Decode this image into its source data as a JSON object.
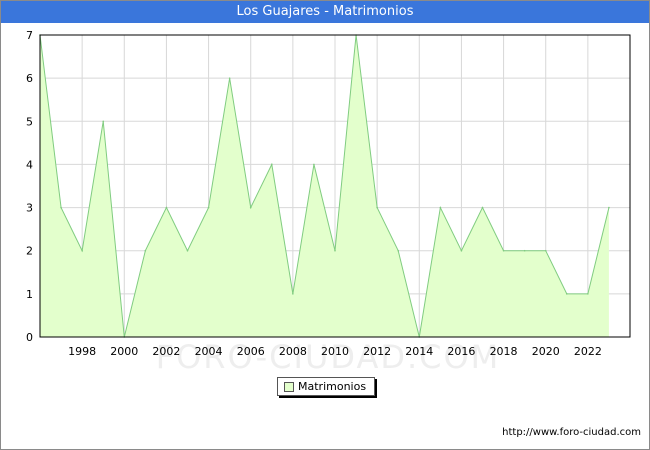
{
  "title": "Los Guajares - Matrimonios",
  "watermark": "FORO-CIUDAD.COM",
  "footer_url": "http://www.foro-ciudad.com",
  "colors": {
    "header": "#3a76db",
    "area_fill": "#e3ffcc",
    "line": "#80cc80",
    "grid": "#d8d8d8"
  },
  "chart_data": {
    "type": "area",
    "title": "Los Guajares - Matrimonios",
    "x": [
      1996,
      1997,
      1998,
      1999,
      2000,
      2001,
      2002,
      2003,
      2004,
      2005,
      2006,
      2007,
      2008,
      2009,
      2010,
      2011,
      2012,
      2013,
      2014,
      2015,
      2016,
      2017,
      2018,
      2019,
      2020,
      2021,
      2022,
      2023
    ],
    "series": [
      {
        "name": "Matrimonios",
        "values": [
          7,
          3,
          2,
          5,
          0,
          2,
          3,
          2,
          3,
          6,
          3,
          4,
          1,
          4,
          2,
          7,
          3,
          2,
          0,
          3,
          2,
          3,
          2,
          2,
          2,
          1,
          1,
          3
        ]
      }
    ],
    "x_ticks": [
      "1998",
      "2000",
      "2002",
      "2004",
      "2006",
      "2008",
      "2010",
      "2012",
      "2014",
      "2016",
      "2018",
      "2020",
      "2022"
    ],
    "y_ticks": [
      "0",
      "1",
      "2",
      "3",
      "4",
      "5",
      "6",
      "7"
    ],
    "xlim": [
      1996,
      2024
    ],
    "ylim": [
      0,
      7
    ],
    "grid": true,
    "legend_position": "bottom-center"
  }
}
